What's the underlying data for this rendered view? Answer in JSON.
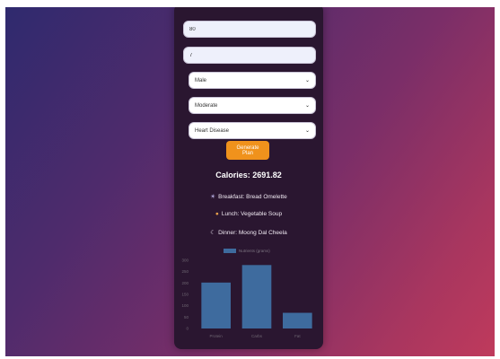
{
  "form": {
    "weight_value": "80",
    "height_value": "7",
    "gender_selected": "Male",
    "activity_selected": "Moderate",
    "condition_selected": "Heart Disease",
    "generate_label": "Generate Plan"
  },
  "result": {
    "calories_text": "Calories: 2691.82"
  },
  "meals": [
    {
      "icon": "sunrise-icon",
      "glyph": "☀",
      "text": "Breakfast: Bread Omelette"
    },
    {
      "icon": "bowl-icon",
      "glyph": "●",
      "text": "Lunch: Vegetable Soup"
    },
    {
      "icon": "moon-icon",
      "glyph": "☾",
      "text": "Dinner: Moong Dal Cheela"
    }
  ],
  "colors": {
    "accent": "#f0921c",
    "bar": "#3e6b9e",
    "card": "#2a1630"
  },
  "chart_data": {
    "type": "bar",
    "title": "",
    "legend": "Nutrients (grams)",
    "categories": [
      "Protein",
      "Carbs",
      "Fat"
    ],
    "series": [
      {
        "name": "Nutrients (grams)",
        "values": [
          202,
          279,
          69
        ]
      }
    ],
    "ylim": [
      0,
      300
    ],
    "yticks": [
      0,
      50,
      100,
      150,
      200,
      250,
      300
    ],
    "xlabel": "",
    "ylabel": "",
    "grid": false,
    "legend_position": "top"
  }
}
